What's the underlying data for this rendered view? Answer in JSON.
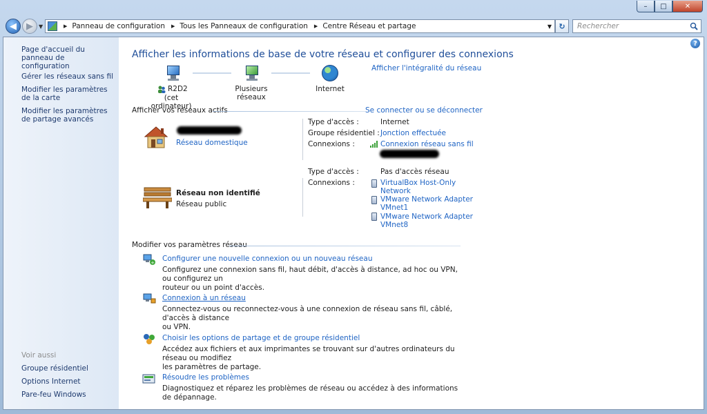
{
  "window": {
    "minimize": "–",
    "maximize": "□",
    "close": "✕"
  },
  "address_bar": {
    "crumbs": [
      "Panneau de configuration",
      "Tous les Panneaux de configuration",
      "Centre Réseau et partage"
    ]
  },
  "search": {
    "placeholder": "Rechercher"
  },
  "sidebar": {
    "links": [
      "Page d'accueil du panneau de configuration",
      "Gérer les réseaux sans fil",
      "Modifier les paramètres de la carte",
      "Modifier les paramètres de partage avancés"
    ],
    "see_also_heading": "Voir aussi",
    "see_also": [
      "Groupe résidentiel",
      "Options Internet",
      "Pare-feu Windows"
    ]
  },
  "main": {
    "title": "Afficher les informations de base de votre réseau et configurer des connexions",
    "view_full_map": "Afficher l'intégralité du réseau",
    "map": {
      "computer_name": "R2D2",
      "computer_sub": "(cet ordinateur)",
      "middle": "Plusieurs réseaux",
      "internet": "Internet"
    },
    "active_networks_heading": "Afficher vos réseaux actifs",
    "connect_disconnect": "Se connecter ou se déconnecter",
    "network1": {
      "type": "Réseau domestique",
      "access_label": "Type d'accès :",
      "access_value": "Internet",
      "homegroup_label": "Groupe résidentiel :",
      "homegroup_value": "Jonction effectuée",
      "connections_label": "Connexions :",
      "connection_value": "Connexion réseau sans fil"
    },
    "network2": {
      "name": "Réseau non identifié",
      "type": "Réseau public",
      "access_label": "Type d'accès :",
      "access_value": "Pas d'accès réseau",
      "connections_label": "Connexions :",
      "connections": [
        {
          "line1": "VirtualBox Host-Only",
          "line2": "Network"
        },
        {
          "line1": "VMware Network Adapter",
          "line2": "VMnet1"
        },
        {
          "line1": "VMware Network Adapter",
          "line2": "VMnet8"
        }
      ]
    },
    "modify_heading": "Modifier vos paramètres réseau",
    "tasks": [
      {
        "title": "Configurer une nouvelle connexion ou un nouveau réseau",
        "desc1": "Configurez une connexion sans fil, haut débit, d'accès à distance, ad hoc ou VPN, ou configurez un",
        "desc2": "routeur ou un point d'accès."
      },
      {
        "title": "Connexion à un réseau",
        "desc1": "Connectez-vous ou reconnectez-vous à une connexion de réseau sans fil, câblé, d'accès à distance",
        "desc2": "ou VPN."
      },
      {
        "title": "Choisir les options de partage et de groupe résidentiel",
        "desc1": "Accédez aux fichiers et aux imprimantes se trouvant sur d'autres ordinateurs du réseau ou modifiez",
        "desc2": "les paramètres de partage."
      },
      {
        "title": "Résoudre les problèmes",
        "desc1": "Diagnostiquez et réparez les problèmes de réseau ou accédez à des informations de dépannage.",
        "desc2": ""
      }
    ]
  },
  "help": "?",
  "colors": {
    "link": "#1f64c4",
    "title": "#1f4e99",
    "sidebar_link": "#1e3a6e"
  }
}
